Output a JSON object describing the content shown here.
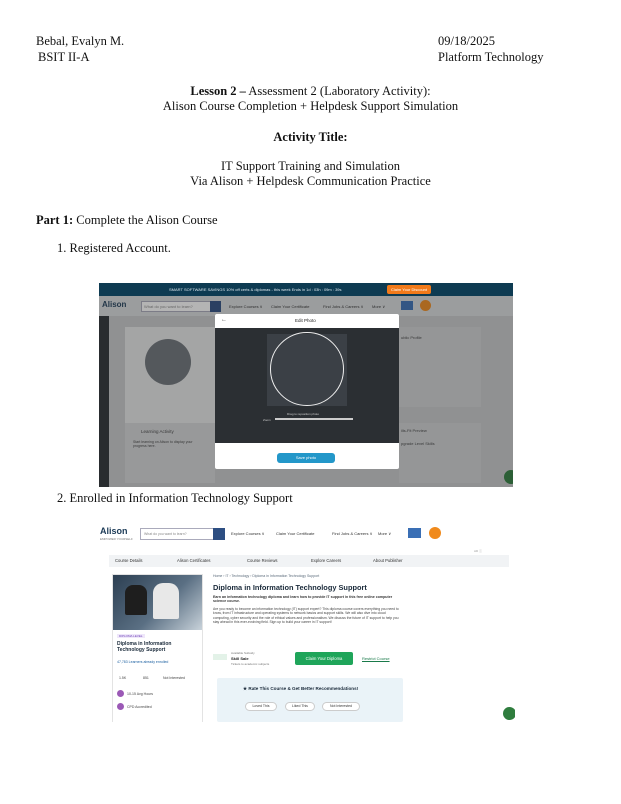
{
  "header": {
    "name": "Bebal, Evalyn M.",
    "section": "BSIT II-A",
    "date": "09/18/2025",
    "subject": "Platform Technology"
  },
  "lesson": {
    "label": "Lesson 2 –",
    "rest": " Assessment 2 (Laboratory Activity):",
    "line2": "Alison Course Completion + Helpdesk Support Simulation"
  },
  "activity": {
    "title_label": "Activity Title:",
    "line1": "IT Support Training and Simulation",
    "line2": "Via Alison + Helpdesk Communication Practice"
  },
  "part1": {
    "label": "Part 1:",
    "text": " Complete the Alison Course"
  },
  "steps": [
    "1. Registered Account.",
    "2. Enrolled in Information Technology Support"
  ],
  "shot1": {
    "banner": "SMART SOFTWARE SAVINGS   10% off certs & diplomas - this week   Ends in 1d : 03h : 09m : 39s",
    "claim_label": "Claim Your Discount",
    "logo": "Alison",
    "search_placeholder": "What do you want to learn?",
    "nav": [
      "Explore Courses ∨",
      "Claim Your Certificate",
      "Find Jobs & Careers ∨",
      "More ∨"
    ],
    "modal_title": "Edit Photo",
    "drag_hint": "Drag to reposition photo",
    "zoom_label": "Zoom",
    "save_label": "Save photo",
    "learning_activity": "Learning Activity",
    "learning_text": "Start learning on Alison to display your progress here.",
    "public_profile": "ublic Profile",
    "upgrade_label": "pgrade Level Skills",
    "preview_label": "ills-Fit Preview"
  },
  "shot2": {
    "logo": "Alison",
    "logo_sub": "EMPOWER YOURSELF",
    "search_placeholder": "What do you want to learn?",
    "nav": [
      "Explore Courses ∨",
      "Claim Your Certificate",
      "Find Jobs & Careers ∨",
      "More ∨"
    ],
    "tabs": [
      "Course Details",
      "Alison Certificates",
      "Course Reviews",
      "Explore Careers",
      "About Publisher"
    ],
    "breadcrumb": "Home › IT › Technology › Diploma in Information Technology Support",
    "title": "Diploma in Information Technology Support",
    "subtitle": "Earn an information technology diploma and learn how to provide IT support in this free online computer science course.",
    "description": "Are you ready to become an information technology (IT) support expert? This diploma course covers everything you need to know, from IT infrastructure and operating systems to network basics and support skills. We will also dive into cloud computing, cyber security and the role of ethical values and professionalism. We discuss the future of IT support to help you stay ahead in this ever-evolving field. Sign up to build your career in IT support!",
    "skill_label": "Available Subsidy",
    "skill_value": "Skill Sale",
    "skill_sub": "Tickets to academic subjects",
    "start_label": "Claim Your Diploma",
    "restrict_label": "Restrict Course",
    "badge": "DIPLOMA LEVEL",
    "card_title": "Diploma in Information Technology Support",
    "learners": "47,783 Learners already enrolled",
    "stats": [
      "1.5K",
      "851",
      "Not Interested"
    ],
    "hours": "10-15 Avg Hours",
    "cpd": "CPD Accredited",
    "rate_title": "Rate This Course & Get Better Recommendations!",
    "rate_options": [
      "Loved This",
      "Liked This",
      "Not Interested"
    ],
    "ad_label": "AD ⓘ"
  }
}
